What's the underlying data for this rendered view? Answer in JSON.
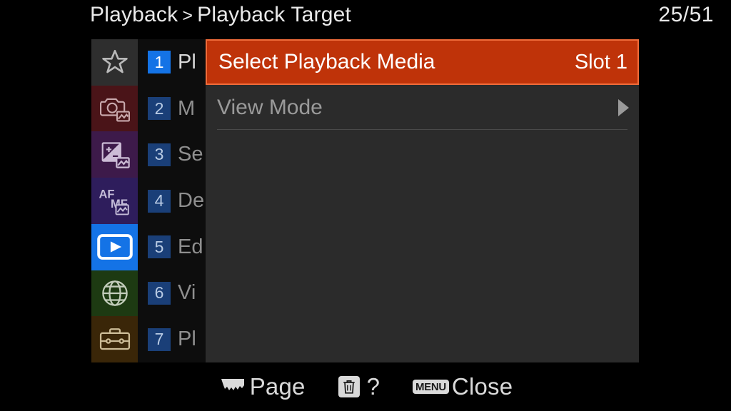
{
  "header": {
    "breadcrumb_root": "Playback",
    "breadcrumb_separator": ">",
    "breadcrumb_current": "Playback Target",
    "page_counter": "25/51"
  },
  "sidebar": {
    "categories": [
      {
        "icon": "star-icon",
        "name": "my-menu",
        "color": "#2e2e2e"
      },
      {
        "icon": "camera-icon",
        "name": "shooting",
        "color": "#4a1418"
      },
      {
        "icon": "exposure-icon",
        "name": "exposure",
        "color": "#3d1a4a"
      },
      {
        "icon": "afmf-icon",
        "name": "focus",
        "color": "#2e1d5c"
      },
      {
        "icon": "playback-icon",
        "name": "playback",
        "color": "#1473e6"
      },
      {
        "icon": "globe-icon",
        "name": "network",
        "color": "#1d3a12"
      },
      {
        "icon": "toolbox-icon",
        "name": "setup",
        "color": "#3a2608"
      }
    ],
    "tabs": [
      {
        "number": "1",
        "label": "Pl",
        "selected": true
      },
      {
        "number": "2",
        "label": "M",
        "selected": false
      },
      {
        "number": "3",
        "label": "Se",
        "selected": false
      },
      {
        "number": "4",
        "label": "De",
        "selected": false
      },
      {
        "number": "5",
        "label": "Ed",
        "selected": false
      },
      {
        "number": "6",
        "label": "Vi",
        "selected": false
      },
      {
        "number": "7",
        "label": "Pl",
        "selected": false
      }
    ]
  },
  "content": {
    "rows": [
      {
        "label": "Select Playback Media",
        "value": "Slot 1",
        "type": "value",
        "highlighted": true
      },
      {
        "label": "View Mode",
        "value": "",
        "type": "submenu",
        "highlighted": false
      }
    ]
  },
  "bottom_bar": {
    "page_label": "Page",
    "help_label": "?",
    "menu_badge": "MENU",
    "close_label": "Close"
  },
  "colors": {
    "highlight": "#bf3309",
    "highlight_border": "#f06c3a",
    "panel_background": "#2b2b2b",
    "tab_column_background": "#0d0d0d",
    "accent_blue": "#1473e6"
  }
}
